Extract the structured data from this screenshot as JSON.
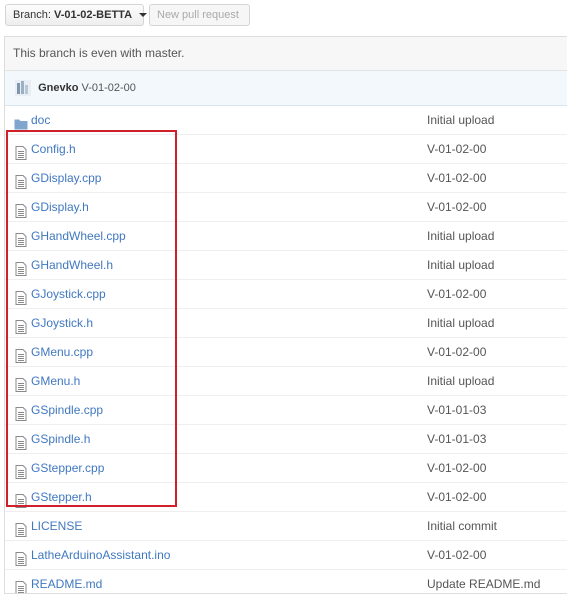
{
  "toolbar": {
    "branch_prefix": "Branch:",
    "branch_name": "V-01-02-BETTA",
    "new_pull_request": "New pull request"
  },
  "status": {
    "text": "This branch is even with master."
  },
  "commit": {
    "author": "Gnevko",
    "message": "V-01-02-00"
  },
  "files": [
    {
      "name": "doc",
      "type": "folder",
      "message": "Initial upload"
    },
    {
      "name": "Config.h",
      "type": "file",
      "message": "V-01-02-00"
    },
    {
      "name": "GDisplay.cpp",
      "type": "file",
      "message": "V-01-02-00"
    },
    {
      "name": "GDisplay.h",
      "type": "file",
      "message": "V-01-02-00"
    },
    {
      "name": "GHandWheel.cpp",
      "type": "file",
      "message": "Initial upload"
    },
    {
      "name": "GHandWheel.h",
      "type": "file",
      "message": "Initial upload"
    },
    {
      "name": "GJoystick.cpp",
      "type": "file",
      "message": "V-01-02-00"
    },
    {
      "name": "GJoystick.h",
      "type": "file",
      "message": "Initial upload"
    },
    {
      "name": "GMenu.cpp",
      "type": "file",
      "message": "V-01-02-00"
    },
    {
      "name": "GMenu.h",
      "type": "file",
      "message": "Initial upload"
    },
    {
      "name": "GSpindle.cpp",
      "type": "file",
      "message": "V-01-01-03"
    },
    {
      "name": "GSpindle.h",
      "type": "file",
      "message": "V-01-01-03"
    },
    {
      "name": "GStepper.cpp",
      "type": "file",
      "message": "V-01-02-00"
    },
    {
      "name": "GStepper.h",
      "type": "file",
      "message": "V-01-02-00"
    },
    {
      "name": "LICENSE",
      "type": "file",
      "message": "Initial commit"
    },
    {
      "name": "LatheArduinoAssistant.ino",
      "type": "file",
      "message": "V-01-02-00"
    },
    {
      "name": "README.md",
      "type": "file",
      "message": "Update README.md"
    }
  ],
  "colors": {
    "link": "#4078c0",
    "highlight": "#d0202a",
    "folder": "#80a6cd"
  }
}
